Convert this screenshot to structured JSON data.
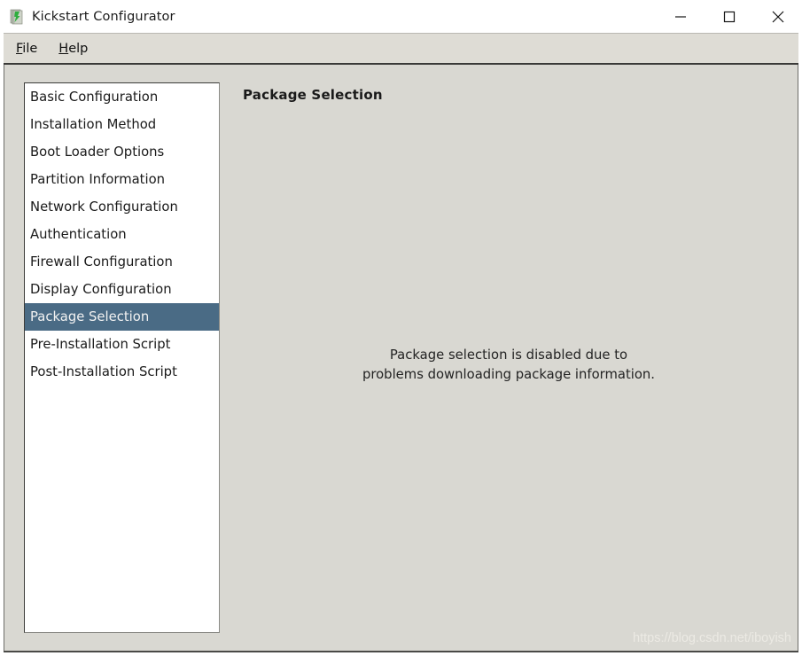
{
  "window": {
    "title": "Kickstart Configurator",
    "icon": "kickstart-app-icon",
    "controls": {
      "minimize": "minimize-icon",
      "maximize": "maximize-icon",
      "close": "close-icon"
    }
  },
  "menubar": {
    "items": [
      {
        "label": "File",
        "accel": "F",
        "rest": "ile"
      },
      {
        "label": "Help",
        "accel": "H",
        "rest": "elp"
      }
    ]
  },
  "sidebar": {
    "items": [
      {
        "label": "Basic Configuration",
        "selected": false
      },
      {
        "label": "Installation Method",
        "selected": false
      },
      {
        "label": "Boot Loader Options",
        "selected": false
      },
      {
        "label": "Partition Information",
        "selected": false
      },
      {
        "label": "Network Configuration",
        "selected": false
      },
      {
        "label": "Authentication",
        "selected": false
      },
      {
        "label": "Firewall Configuration",
        "selected": false
      },
      {
        "label": "Display Configuration",
        "selected": false
      },
      {
        "label": "Package Selection",
        "selected": true
      },
      {
        "label": "Pre-Installation Script",
        "selected": false
      },
      {
        "label": "Post-Installation Script",
        "selected": false
      }
    ]
  },
  "main": {
    "heading": "Package Selection",
    "message_lines": [
      "Package selection is disabled due to",
      "problems downloading package information."
    ]
  },
  "watermark": {
    "text": "https://blog.csdn.net/iboyish"
  },
  "colors": {
    "selection": "#4a6b85",
    "window_background": "#d9d8d2",
    "titlebar_background": "#ffffff",
    "list_background": "#ffffff"
  }
}
